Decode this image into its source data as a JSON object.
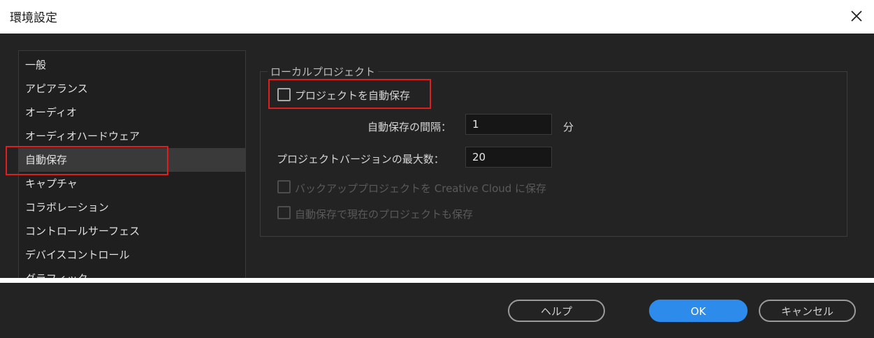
{
  "window": {
    "title": "環境設定"
  },
  "sidebar": {
    "items": [
      {
        "label": "一般"
      },
      {
        "label": "アピアランス"
      },
      {
        "label": "オーディオ"
      },
      {
        "label": "オーディオハードウェア"
      },
      {
        "label": "自動保存",
        "selected": true
      },
      {
        "label": "キャプチャ"
      },
      {
        "label": "コラボレーション"
      },
      {
        "label": "コントロールサーフェス"
      },
      {
        "label": "デバイスコントロール"
      },
      {
        "label": "グラフィック"
      }
    ]
  },
  "panel": {
    "group_title": "ローカルプロジェクト",
    "auto_save": {
      "label": "プロジェクトを自動保存",
      "checked": false
    },
    "interval": {
      "label": "自動保存の間隔：",
      "value": "1",
      "unit": "分"
    },
    "max_versions": {
      "label": "プロジェクトバージョンの最大数：",
      "value": "20"
    },
    "cloud_backup": {
      "label": "バックアッププロジェクトを Creative Cloud に保存",
      "checked": false,
      "enabled": false
    },
    "save_current": {
      "label": "自動保存で現在のプロジェクトも保存",
      "checked": false,
      "enabled": false
    }
  },
  "footer": {
    "help_label": "ヘルプ",
    "ok_label": "OK",
    "cancel_label": "キャンセル"
  },
  "colors": {
    "highlight": "#e01e1e",
    "accent": "#2d8ceb",
    "background": "#232323"
  }
}
